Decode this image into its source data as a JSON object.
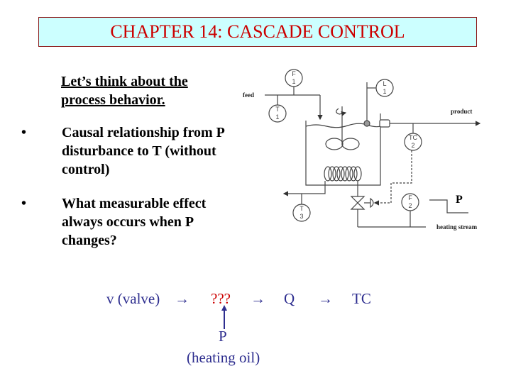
{
  "title": "CHAPTER 14: CASCADE CONTROL",
  "intro": "Let’s think about the process behavior.",
  "bullets": [
    {
      "marker": "•",
      "text": "Causal relationship from P disturbance to T (without control)"
    },
    {
      "marker": "•",
      "text": "What measurable effect always occurs when P changes?"
    }
  ],
  "diagram": {
    "labels": {
      "feed": "feed",
      "product": "product",
      "heating_stream": "heating stream",
      "disturbance": "P"
    },
    "instruments": [
      {
        "id": "F1",
        "line1": "F",
        "line2": "1"
      },
      {
        "id": "T1",
        "line1": "T",
        "line2": "1"
      },
      {
        "id": "L1",
        "line1": "L",
        "line2": "1"
      },
      {
        "id": "TC2",
        "line1": "TC",
        "line2": "2"
      },
      {
        "id": "F2",
        "line1": "F",
        "line2": "2"
      },
      {
        "id": "T3",
        "line1": "T",
        "line2": "3"
      }
    ]
  },
  "causal_chain": {
    "valve": "v (valve)",
    "arrow": "→",
    "unknown": "???",
    "q": "Q",
    "tc": "TC",
    "disturbance": "P",
    "disturbance_desc": "(heating oil)"
  },
  "colors": {
    "title_text": "#cc0000",
    "title_bg": "#ccffff",
    "chain_text": "#2e2e8f",
    "unknown_text": "#cc0000"
  }
}
